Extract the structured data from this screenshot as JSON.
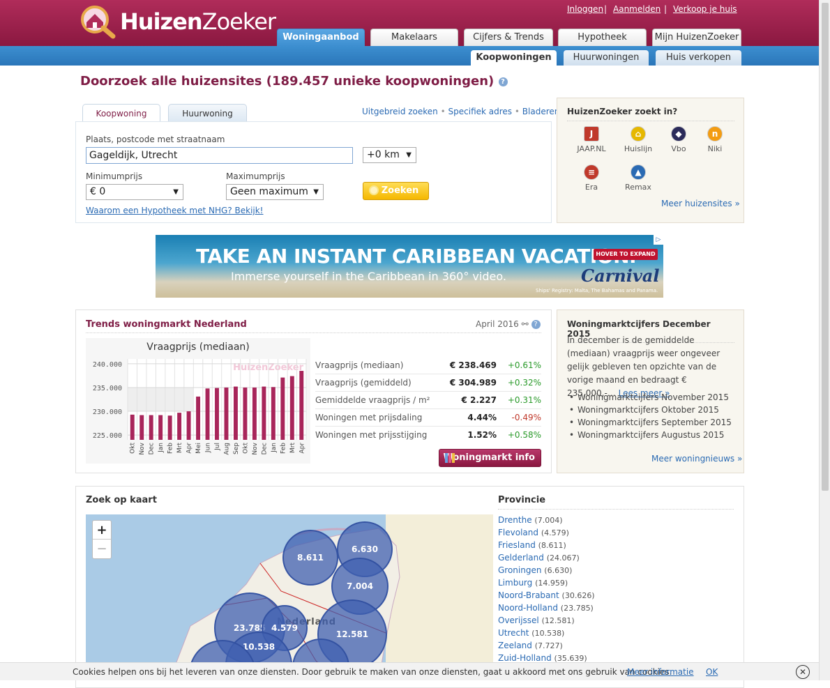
{
  "header": {
    "logo_text_bold": "Huizen",
    "logo_text_light": "Zoeker",
    "links": [
      "Inloggen",
      "Aanmelden",
      "Verkoop je huis"
    ],
    "tabs": [
      "Woningaanbod",
      "Makelaars",
      "Cijfers & Trends",
      "Hypotheek",
      "Mijn HuizenZoeker"
    ],
    "subtabs": [
      "Koopwoningen",
      "Huurwoningen",
      "Huis verkopen"
    ]
  },
  "page_title": "Doorzoek alle huizensites (189.457 unieke koopwoningen)",
  "search": {
    "tabs": [
      "Koopwoning",
      "Huurwoning"
    ],
    "links": [
      "Uitgebreid zoeken",
      "Specifiek adres",
      "Bladeren"
    ],
    "place_label": "Plaats, postcode met straatnaam",
    "place_value": "Gageldijk, Utrecht",
    "radius": "+0 km",
    "min_label": "Minimumprijs",
    "min_value": "€ 0",
    "max_label": "Maximumprijs",
    "max_value": "Geen maximum",
    "button": "Zoeken",
    "nhg_link": "Waarom een Hypotheek met NHG? Bekijk!"
  },
  "sites": {
    "title": "HuizenZoeker zoekt in?",
    "items": [
      {
        "name": "JAAP.NL",
        "icon": "J",
        "color": "#c0392b"
      },
      {
        "name": "Huislijn",
        "icon": "⌂",
        "color": "#e6b800"
      },
      {
        "name": "Vbo",
        "icon": "◆",
        "color": "#2b2b5a"
      },
      {
        "name": "Niki",
        "icon": "n",
        "color": "#f39c12"
      },
      {
        "name": "Era",
        "icon": "≡",
        "color": "#c0392b"
      },
      {
        "name": "Remax",
        "icon": "▲",
        "color": "#2a6ab3"
      }
    ],
    "more": "Meer huizensites »"
  },
  "ad": {
    "headline": "TAKE AN INSTANT CARIBBEAN VACATION.",
    "sub": "Immerse yourself in the Caribbean in 360° video.",
    "expand": "HOVER TO EXPAND",
    "brand": "Carnival",
    "fine": "Ships' Registry: Malta, The Bahamas and Panama."
  },
  "trends": {
    "title": "Trends woningmarkt Nederland",
    "date": "April 2016",
    "rows": [
      {
        "name": "Vraagprijs (mediaan)",
        "value": "€ 238.469",
        "change": "+0.61%",
        "dir": "pos"
      },
      {
        "name": "Vraagprijs (gemiddeld)",
        "value": "€ 304.989",
        "change": "+0.32%",
        "dir": "pos"
      },
      {
        "name": "Gemiddelde vraagprijs / m²",
        "value": "€ 2.227",
        "change": "+0.31%",
        "dir": "pos"
      },
      {
        "name": "Woningen met prijsdaling",
        "value": "4.44%",
        "change": "-0.49%",
        "dir": "neg"
      },
      {
        "name": "Woningen met prijsstijging",
        "value": "1.52%",
        "change": "+0.58%",
        "dir": "pos"
      }
    ],
    "button": "Woningmarkt info"
  },
  "chart_data": {
    "type": "bar",
    "title": "Vraagprijs (mediaan)",
    "watermark": "HuizenZoeker",
    "categories": [
      "Okt",
      "Nov",
      "Dec",
      "Jan",
      "Feb",
      "Mrt",
      "Apr",
      "Mei",
      "Jun",
      "Jul",
      "Aug",
      "Sep",
      "Okt",
      "Nov",
      "Dec",
      "Jan",
      "Feb",
      "Mrt",
      "Apr"
    ],
    "values": [
      229.3,
      229.2,
      229.2,
      229.2,
      229.1,
      229.7,
      230.0,
      233.1,
      234.8,
      234.9,
      235.0,
      235.2,
      235.0,
      235.0,
      235.2,
      235.1,
      237.1,
      237.4,
      238.5
    ],
    "ylim": [
      224.0,
      241.0
    ],
    "yticks": [
      "240.000",
      "235.000",
      "230.000",
      "225.000"
    ],
    "ytick_values": [
      240,
      235,
      230,
      225
    ],
    "bar_color": "#a8255a"
  },
  "news": {
    "title": "Woningmarktcijfers December 2015",
    "body": "In december is de gemiddelde (mediaan) vraagprijs weer ongeveer gelijk gebleven ten opzichte van de vorige maand en bedraagt € 235,000,-…",
    "more_inline": "Lees meer »",
    "items": [
      "Woningmarktcijfers November 2015",
      "Woningmarktcijfers Oktober 2015",
      "Woningmarktcijfers September 2015",
      "Woningmarktcijfers Augustus 2015"
    ],
    "more": "Meer woningnieuws »"
  },
  "map": {
    "title": "Zoek op kaart",
    "zoom_in": "+",
    "zoom_out": "−",
    "label": "Nederland",
    "bubbles": [
      "8.611",
      "6.630",
      "7.004",
      "23.785",
      "4.579",
      "12.581",
      "10.538"
    ]
  },
  "provinces": {
    "title": "Provincie",
    "items": [
      {
        "name": "Drenthe",
        "count": "(7.004)"
      },
      {
        "name": "Flevoland",
        "count": "(4.579)"
      },
      {
        "name": "Friesland",
        "count": "(8.611)"
      },
      {
        "name": "Gelderland",
        "count": "(24.067)"
      },
      {
        "name": "Groningen",
        "count": "(6.630)"
      },
      {
        "name": "Limburg",
        "count": "(14.959)"
      },
      {
        "name": "Noord-Brabant",
        "count": "(30.626)"
      },
      {
        "name": "Noord-Holland",
        "count": "(23.785)"
      },
      {
        "name": "Overijssel",
        "count": "(12.581)"
      },
      {
        "name": "Utrecht",
        "count": "(10.538)"
      },
      {
        "name": "Zeeland",
        "count": "(7.727)"
      },
      {
        "name": "Zuid-Holland",
        "count": "(35.639)"
      }
    ]
  },
  "cookie": {
    "text": "Cookies helpen ons bij het leveren van onze diensten. Door gebruik te maken van onze diensten, gaat u akkoord met ons gebruik van cookies.",
    "more": "Meer informatie",
    "ok": "OK"
  }
}
